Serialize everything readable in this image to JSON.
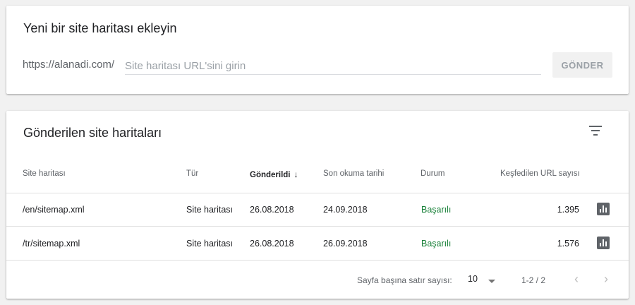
{
  "add_card": {
    "title": "Yeni bir site haritası ekleyin",
    "url_prefix": "https://alanadi.com/",
    "input_placeholder": "Site haritası URL'sini girin",
    "submit_label": "GÖNDER"
  },
  "list_card": {
    "title": "Gönderilen site haritaları",
    "filter_icon": "filter-list-icon",
    "columns": {
      "sitemap": "Site haritası",
      "type": "Tür",
      "submitted": "Gönderildi",
      "last_read": "Son okuma tarihi",
      "status": "Durum",
      "discovered": "Keşfedilen URL sayısı"
    },
    "sort_icon": "arrow-down-icon",
    "rows": [
      {
        "sitemap": "/en/sitemap.xml",
        "type": "Site haritası",
        "submitted": "26.08.2018",
        "last_read": "24.09.2018",
        "status": "Başarılı",
        "discovered": "1.395",
        "action_icon": "bar-chart-icon"
      },
      {
        "sitemap": "/tr/sitemap.xml",
        "type": "Site haritası",
        "submitted": "26.08.2018",
        "last_read": "26.09.2018",
        "status": "Başarılı",
        "discovered": "1.576",
        "action_icon": "bar-chart-icon"
      }
    ],
    "footer": {
      "rows_per_page_label": "Sayfa başına satır sayısı:",
      "rows_per_page_value": "10",
      "range_label": "1-2 / 2",
      "prev_icon": "chevron-left-icon",
      "next_icon": "chevron-right-icon"
    }
  },
  "colors": {
    "status_success": "#188038",
    "background": "#f1f1f1",
    "icon": "#5f6368"
  }
}
